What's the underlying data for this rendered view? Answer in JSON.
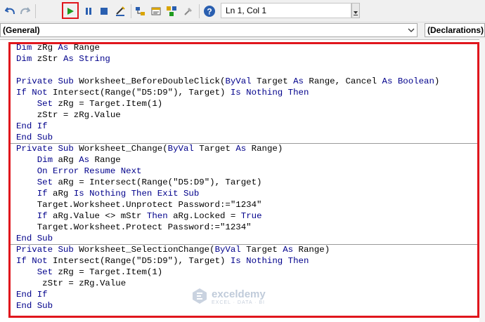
{
  "toolbar": {
    "cursor_location": "Ln 1, Col 1",
    "icons": [
      "undo-icon",
      "redo-icon",
      "run-icon",
      "break-icon",
      "reset-icon",
      "design-mode-icon",
      "project-explorer-icon",
      "properties-icon",
      "object-browser-icon",
      "toolbox-icon",
      "help-icon"
    ]
  },
  "object_combo": {
    "value": "(General)"
  },
  "procedure_combo": {
    "value": "(Declarations)"
  },
  "code_lines": [
    [
      {
        "t": "Dim",
        "k": 1
      },
      {
        "t": " zRg "
      },
      {
        "t": "As",
        "k": 1
      },
      {
        "t": " Range"
      }
    ],
    [
      {
        "t": "Dim",
        "k": 1
      },
      {
        "t": " zStr "
      },
      {
        "t": "As",
        "k": 1
      },
      {
        "t": " "
      },
      {
        "t": "String",
        "k": 1
      }
    ],
    [],
    [
      {
        "t": "Private Sub",
        "k": 1
      },
      {
        "t": " Worksheet_BeforeDoubleClick("
      },
      {
        "t": "ByVal",
        "k": 1
      },
      {
        "t": " Target "
      },
      {
        "t": "As",
        "k": 1
      },
      {
        "t": " Range, Cancel "
      },
      {
        "t": "As",
        "k": 1
      },
      {
        "t": " "
      },
      {
        "t": "Boolean",
        "k": 1
      },
      {
        "t": ")"
      }
    ],
    [
      {
        "t": "If Not",
        "k": 1
      },
      {
        "t": " Intersect(Range(\"D5:D9\"), Target) "
      },
      {
        "t": "Is Nothing Then",
        "k": 1
      }
    ],
    [
      {
        "t": "    "
      },
      {
        "t": "Set",
        "k": 1
      },
      {
        "t": " zRg = Target.Item(1)"
      }
    ],
    [
      {
        "t": "    zStr = zRg.Value"
      }
    ],
    [
      {
        "t": "End If",
        "k": 1
      }
    ],
    [
      {
        "t": "End Sub",
        "k": 1
      }
    ],
    [
      {
        "t": "Private Sub",
        "k": 1
      },
      {
        "t": " Worksheet_Change("
      },
      {
        "t": "ByVal",
        "k": 1
      },
      {
        "t": " Target "
      },
      {
        "t": "As",
        "k": 1
      },
      {
        "t": " Range)"
      }
    ],
    [
      {
        "t": "    "
      },
      {
        "t": "Dim",
        "k": 1
      },
      {
        "t": " aRg "
      },
      {
        "t": "As",
        "k": 1
      },
      {
        "t": " Range"
      }
    ],
    [
      {
        "t": "    "
      },
      {
        "t": "On Error Resume Next",
        "k": 1
      }
    ],
    [
      {
        "t": "    "
      },
      {
        "t": "Set",
        "k": 1
      },
      {
        "t": " aRg = Intersect(Range(\"D5:D9\"), Target)"
      }
    ],
    [
      {
        "t": "    "
      },
      {
        "t": "If",
        "k": 1
      },
      {
        "t": " aRg "
      },
      {
        "t": "Is Nothing Then Exit Sub",
        "k": 1
      }
    ],
    [
      {
        "t": "    Target.Worksheet.Unprotect Password:=\"1234\""
      }
    ],
    [
      {
        "t": "    "
      },
      {
        "t": "If",
        "k": 1
      },
      {
        "t": " aRg.Value <> mStr "
      },
      {
        "t": "Then",
        "k": 1
      },
      {
        "t": " aRg.Locked = "
      },
      {
        "t": "True",
        "k": 1
      }
    ],
    [
      {
        "t": "    Target.Worksheet.Protect Password:=\"1234\""
      }
    ],
    [
      {
        "t": "End Sub",
        "k": 1
      }
    ],
    [
      {
        "t": "Private Sub",
        "k": 1
      },
      {
        "t": " Worksheet_SelectionChange("
      },
      {
        "t": "ByVal",
        "k": 1
      },
      {
        "t": " Target "
      },
      {
        "t": "As",
        "k": 1
      },
      {
        "t": " Range)"
      }
    ],
    [
      {
        "t": "If Not",
        "k": 1
      },
      {
        "t": " Intersect(Range(\"D5:D9\"), Target) "
      },
      {
        "t": "Is Nothing Then",
        "k": 1
      }
    ],
    [
      {
        "t": "    "
      },
      {
        "t": "Set",
        "k": 1
      },
      {
        "t": " zRg = Target.Item(1)"
      }
    ],
    [
      {
        "t": "     zStr = zRg.Value"
      }
    ],
    [
      {
        "t": "End If",
        "k": 1
      }
    ],
    [
      {
        "t": "End Sub",
        "k": 1
      }
    ]
  ],
  "watermark": {
    "name": "exceldemy",
    "tagline": "EXCEL · DATA · BI"
  },
  "colors": {
    "keyword": "#00008b",
    "highlight": "#e0161d",
    "run": "#1f9b1f"
  }
}
